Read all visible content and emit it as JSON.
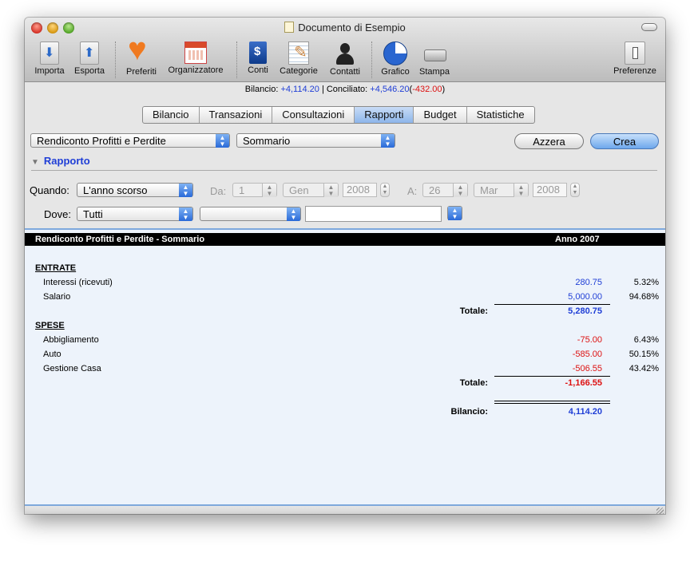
{
  "window": {
    "title": "Documento di Esempio"
  },
  "toolbar": [
    {
      "id": "import",
      "label": "Importa",
      "icon": "import-icon"
    },
    {
      "id": "export",
      "label": "Esporta",
      "icon": "export-icon"
    },
    {
      "id": "favorites",
      "label": "Preferiti",
      "icon": "heart-icon"
    },
    {
      "id": "organizer",
      "label": "Organizzatore",
      "icon": "calendar-icon"
    },
    {
      "id": "accounts",
      "label": "Conti",
      "icon": "accounts-book-icon"
    },
    {
      "id": "categories",
      "label": "Categorie",
      "icon": "categories-notepad-icon"
    },
    {
      "id": "contacts",
      "label": "Contatti",
      "icon": "person-icon"
    },
    {
      "id": "chart",
      "label": "Grafico",
      "icon": "pie-chart-icon"
    },
    {
      "id": "print",
      "label": "Stampa",
      "icon": "printer-icon"
    },
    {
      "id": "prefs",
      "label": "Preferenze",
      "icon": "preferences-switch-icon"
    }
  ],
  "status": {
    "balance_label": "Bilancio:",
    "balance_value": "+4,114.20",
    "separator": "|",
    "reconciled_label": "Conciliato:",
    "reconciled_value": "+4,546.20",
    "reconciled_diff": "-432.00",
    "paren_open": "(",
    "paren_close": ")"
  },
  "tabs": [
    "Bilancio",
    "Transazioni",
    "Consultazioni",
    "Rapporti",
    "Budget",
    "Statistiche"
  ],
  "selected_tab": "Rapporti",
  "controls": {
    "report_type": "Rendiconto Profitti e Perdite",
    "report_style": "Sommario",
    "reset_label": "Azzera",
    "create_label": "Crea"
  },
  "section": {
    "title": "Rapporto"
  },
  "filters": {
    "when_label": "Quando:",
    "when_value": "L'anno scorso",
    "from_label": "Da:",
    "from_day": "1",
    "from_month": "Gen",
    "from_year": "2008",
    "to_label": "A:",
    "to_day": "26",
    "to_month": "Mar",
    "to_year": "2008",
    "where_label": "Dove:",
    "where_value": "Tutti",
    "where_second": "",
    "where_text": ""
  },
  "report": {
    "header_title": "Rendiconto Profitti e Perdite - Sommario",
    "header_period": "Anno 2007",
    "income": {
      "title": "ENTRATE",
      "rows": [
        {
          "name": "Interessi (ricevuti)",
          "amount": "280.75",
          "pct": "5.32%"
        },
        {
          "name": "Salario",
          "amount": "5,000.00",
          "pct": "94.68%"
        }
      ],
      "total_label": "Totale:",
      "total": "5,280.75"
    },
    "expenses": {
      "title": "SPESE",
      "rows": [
        {
          "name": "Abbigliamento",
          "amount": "-75.00",
          "pct": "6.43%"
        },
        {
          "name": "Auto",
          "amount": "-585.00",
          "pct": "50.15%"
        },
        {
          "name": "Gestione Casa",
          "amount": "-506.55",
          "pct": "43.42%"
        }
      ],
      "total_label": "Totale:",
      "total": "-1,166.55"
    },
    "balance_label": "Bilancio:",
    "balance": "4,114.20"
  },
  "colors": {
    "positive": "#1f3ed6",
    "negative": "#d11111",
    "accent": "#2a6ad8"
  }
}
